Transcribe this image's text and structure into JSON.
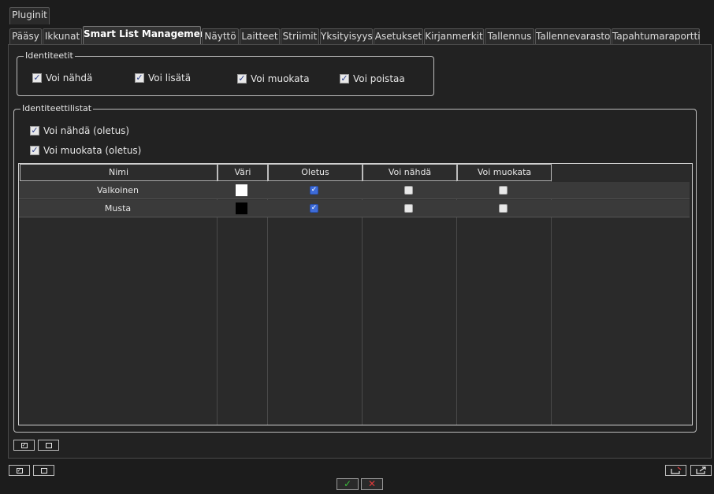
{
  "window": {
    "title": "Pluginit"
  },
  "tabs": [
    {
      "label": "Pääsy"
    },
    {
      "label": "Ikkunat"
    },
    {
      "label": "Smart List Management"
    },
    {
      "label": "Näyttö"
    },
    {
      "label": "Laitteet"
    },
    {
      "label": "Striimit"
    },
    {
      "label": "Yksityisyys"
    },
    {
      "label": "Asetukset"
    },
    {
      "label": "Kirjanmerkit"
    },
    {
      "label": "Tallennus"
    },
    {
      "label": "Tallennevarasto"
    },
    {
      "label": "Tapahtumaraportti"
    }
  ],
  "identities": {
    "title": "Identiteetit",
    "options": [
      {
        "label": "Voi nähdä",
        "checked": true
      },
      {
        "label": "Voi lisätä",
        "checked": true
      },
      {
        "label": "Voi muokata",
        "checked": true
      },
      {
        "label": "Voi poistaa",
        "checked": true
      }
    ]
  },
  "identity_lists": {
    "title": "Identiteettilistat",
    "options": [
      {
        "label": "Voi nähdä (oletus)",
        "checked": true
      },
      {
        "label": "Voi muokata (oletus)",
        "checked": true
      }
    ],
    "columns": [
      "Nimi",
      "Väri",
      "Oletus",
      "Voi nähdä",
      "Voi muokata"
    ],
    "rows": [
      {
        "name": "Valkoinen",
        "color": "#ffffff",
        "default": true,
        "can_view": false,
        "can_edit": false
      },
      {
        "name": "Musta",
        "color": "#000000",
        "default": true,
        "can_view": false,
        "can_edit": false
      }
    ]
  },
  "buttons": {
    "check_all_icon": "check-all-icon",
    "uncheck_all_icon": "uncheck-all-icon",
    "ok_glyph": "✓",
    "cancel_glyph": "✕",
    "ok_color": "#3bbf3b",
    "cancel_color": "#e03a3a"
  }
}
